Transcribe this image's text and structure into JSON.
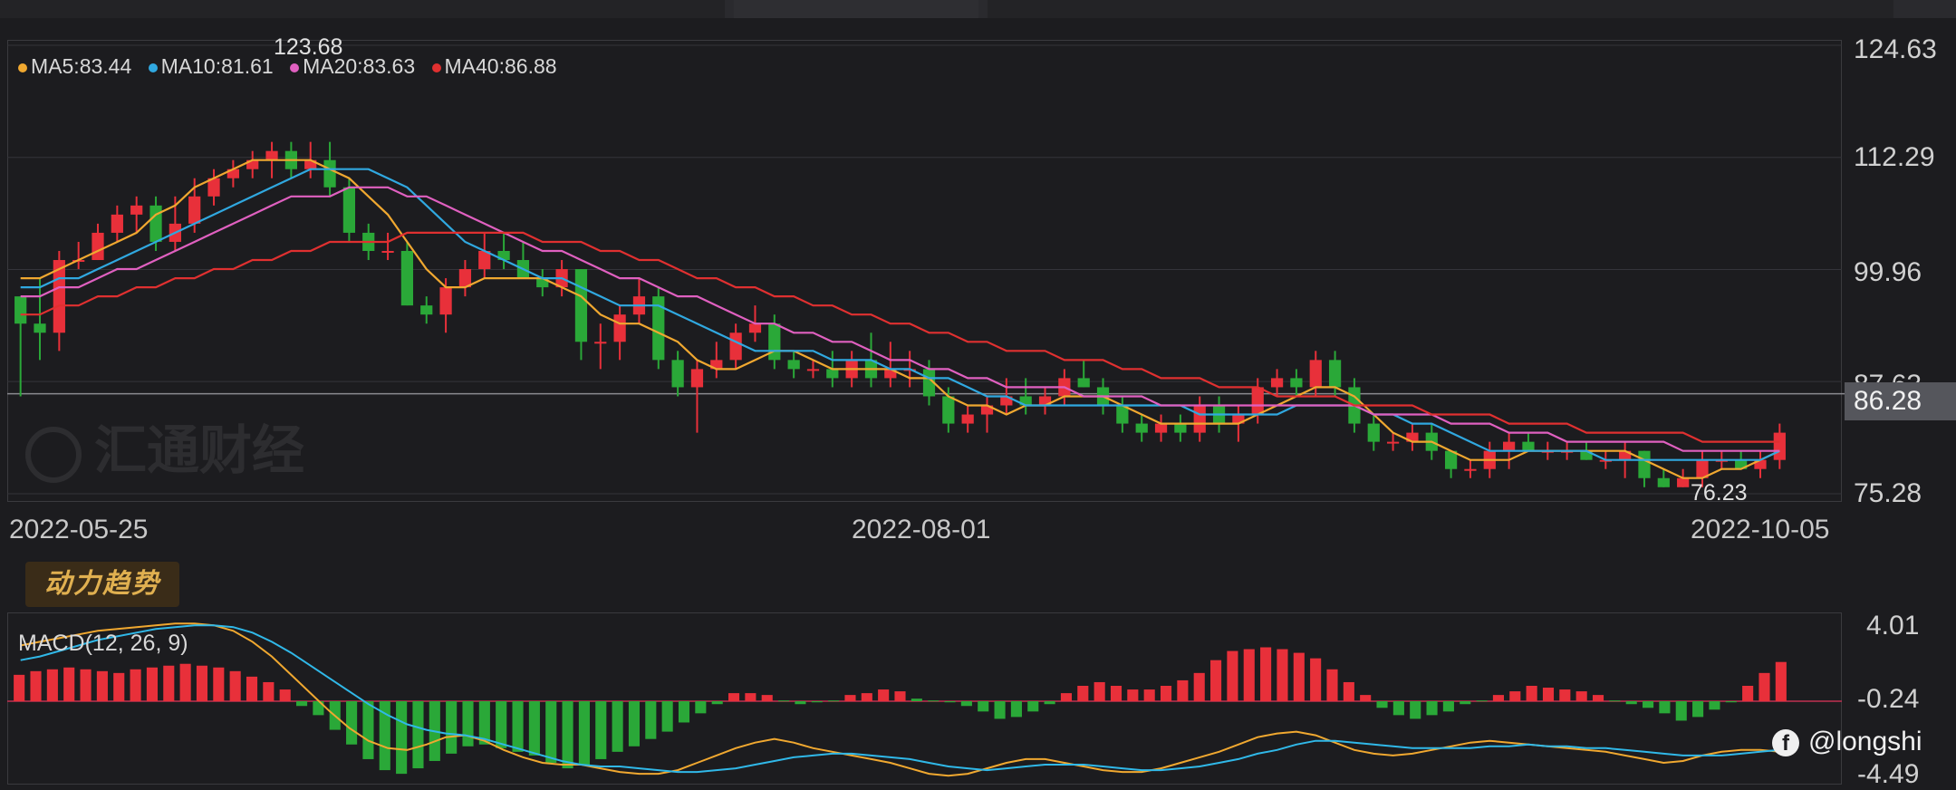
{
  "chart_data": [
    {
      "type": "candlestick",
      "ohlc": [
        [
          97,
          86,
          97,
          94
        ],
        [
          94,
          90,
          99,
          93
        ],
        [
          93,
          91,
          102,
          101
        ],
        [
          101,
          100,
          103,
          101
        ],
        [
          101,
          101,
          105,
          104
        ],
        [
          104,
          103,
          107,
          106
        ],
        [
          106,
          104,
          108,
          107
        ],
        [
          107,
          102,
          108,
          103
        ],
        [
          103,
          102,
          108,
          105
        ],
        [
          105,
          104,
          110,
          108
        ],
        [
          108,
          107,
          111,
          110
        ],
        [
          110,
          109,
          112,
          111
        ],
        [
          111,
          110,
          113,
          112
        ],
        [
          112,
          110,
          114,
          113
        ],
        [
          113,
          110,
          114,
          111
        ],
        [
          111,
          110,
          114,
          112
        ],
        [
          112,
          108,
          114,
          109
        ],
        [
          109,
          103,
          110,
          104
        ],
        [
          104,
          101,
          105,
          102
        ],
        [
          102,
          101,
          104,
          102
        ],
        [
          102,
          96,
          103,
          96
        ],
        [
          96,
          94,
          97,
          95
        ],
        [
          95,
          93,
          99,
          98
        ],
        [
          98,
          97,
          101,
          100
        ],
        [
          100,
          99,
          104,
          102
        ],
        [
          102,
          100,
          104,
          101
        ],
        [
          101,
          99,
          103,
          99
        ],
        [
          99,
          97,
          100,
          98
        ],
        [
          98,
          97,
          101,
          100
        ],
        [
          100,
          90,
          100,
          92
        ],
        [
          92,
          89,
          94,
          92
        ],
        [
          92,
          90,
          96,
          95
        ],
        [
          95,
          94,
          99,
          97
        ],
        [
          97,
          89,
          98,
          90
        ],
        [
          90,
          86,
          91,
          87
        ],
        [
          87,
          82,
          90,
          89
        ],
        [
          89,
          88,
          92,
          90
        ],
        [
          90,
          89,
          94,
          93
        ],
        [
          93,
          92,
          96,
          94
        ],
        [
          94,
          89,
          95,
          90
        ],
        [
          90,
          88,
          91,
          89
        ],
        [
          89,
          88,
          90,
          89
        ],
        [
          89,
          87,
          91,
          88
        ],
        [
          88,
          87,
          91,
          90
        ],
        [
          90,
          87,
          93,
          88
        ],
        [
          88,
          87,
          92,
          89
        ],
        [
          89,
          87,
          91,
          89
        ],
        [
          89,
          85,
          90,
          86
        ],
        [
          86,
          82,
          87,
          83
        ],
        [
          83,
          82,
          85,
          84
        ],
        [
          84,
          82,
          86,
          85
        ],
        [
          85,
          84,
          88,
          86
        ],
        [
          86,
          84,
          88,
          85
        ],
        [
          85,
          84,
          87,
          86
        ],
        [
          86,
          85,
          89,
          88
        ],
        [
          88,
          87,
          90,
          87
        ],
        [
          87,
          84,
          88,
          85
        ],
        [
          85,
          82,
          86,
          83
        ],
        [
          83,
          81,
          84,
          82
        ],
        [
          82,
          81,
          84,
          83
        ],
        [
          83,
          81,
          84,
          82
        ],
        [
          82,
          81,
          86,
          85
        ],
        [
          85,
          82,
          86,
          83
        ],
        [
          83,
          81,
          85,
          84
        ],
        [
          84,
          83,
          88,
          87
        ],
        [
          87,
          86,
          89,
          88
        ],
        [
          88,
          86,
          89,
          87
        ],
        [
          87,
          86,
          91,
          90
        ],
        [
          90,
          86,
          91,
          87
        ],
        [
          87,
          82,
          88,
          83
        ],
        [
          83,
          80,
          84,
          81
        ],
        [
          81,
          80,
          82,
          81
        ],
        [
          81,
          80,
          83,
          82
        ],
        [
          82,
          79,
          83,
          80
        ],
        [
          80,
          77,
          80,
          78
        ],
        [
          78,
          77,
          79,
          78
        ],
        [
          78,
          77,
          81,
          80
        ],
        [
          80,
          78,
          82,
          81
        ],
        [
          81,
          80,
          82,
          80
        ],
        [
          80,
          79,
          81,
          80
        ],
        [
          80,
          79,
          81,
          80
        ],
        [
          80,
          79,
          81,
          79
        ],
        [
          79,
          78,
          80,
          79
        ],
        [
          79,
          77,
          81,
          80
        ],
        [
          80,
          76,
          80,
          77
        ],
        [
          77,
          76,
          78,
          76
        ],
        [
          76,
          76,
          78,
          77
        ],
        [
          77,
          76,
          80,
          79
        ],
        [
          79,
          78,
          80,
          79
        ],
        [
          79,
          78,
          80,
          78
        ],
        [
          78,
          77,
          80,
          79
        ],
        [
          79,
          78,
          83,
          82
        ]
      ],
      "ma_series": [
        {
          "name": "MA5",
          "value_label": "83.44",
          "color": "#f0a830",
          "values": [
            99,
            99,
            100,
            101,
            102,
            103,
            104,
            106,
            107,
            109,
            110,
            111,
            112,
            112,
            112,
            112,
            111,
            110,
            108,
            106,
            103,
            100,
            98,
            98,
            99,
            99,
            99,
            99,
            98,
            97,
            95,
            94,
            94,
            93,
            92,
            90,
            89,
            89,
            90,
            91,
            91,
            90,
            89,
            89,
            89,
            89,
            88,
            88,
            86,
            85,
            85,
            84,
            85,
            85,
            86,
            86,
            86,
            85,
            84,
            83,
            83,
            83,
            83,
            83,
            84,
            85,
            86,
            87,
            87,
            86,
            84,
            82,
            81,
            81,
            80,
            79,
            79,
            79,
            80,
            80,
            80,
            80,
            80,
            80,
            79,
            78,
            77,
            77,
            78,
            78,
            79,
            80
          ]
        },
        {
          "name": "MA10",
          "value_label": "81.61",
          "color": "#30a8e0",
          "values": [
            98,
            98,
            99,
            99,
            100,
            101,
            102,
            103,
            104,
            105,
            106,
            107,
            108,
            109,
            110,
            111,
            111,
            111,
            111,
            110,
            109,
            107,
            105,
            103,
            102,
            101,
            100,
            99,
            99,
            98,
            97,
            96,
            96,
            96,
            95,
            94,
            93,
            92,
            91,
            91,
            91,
            91,
            90,
            90,
            90,
            89,
            89,
            88,
            88,
            87,
            86,
            86,
            85,
            85,
            85,
            85,
            85,
            85,
            85,
            85,
            85,
            84,
            84,
            84,
            84,
            84,
            85,
            85,
            85,
            85,
            84,
            84,
            83,
            83,
            82,
            81,
            80,
            80,
            80,
            80,
            80,
            80,
            79,
            79,
            79,
            79,
            79,
            79,
            79,
            79,
            79,
            80
          ]
        },
        {
          "name": "MA20",
          "value_label": "83.63",
          "color": "#e060c0",
          "values": [
            97,
            97,
            98,
            98,
            99,
            100,
            100,
            101,
            102,
            103,
            104,
            105,
            106,
            107,
            108,
            108,
            108,
            109,
            109,
            109,
            108,
            108,
            107,
            106,
            105,
            104,
            103,
            102,
            102,
            101,
            100,
            99,
            99,
            98,
            97,
            97,
            96,
            95,
            94,
            94,
            93,
            93,
            92,
            92,
            91,
            90,
            90,
            89,
            89,
            88,
            88,
            87,
            87,
            87,
            87,
            86,
            86,
            86,
            86,
            85,
            85,
            85,
            85,
            85,
            85,
            85,
            85,
            85,
            85,
            85,
            84,
            84,
            84,
            84,
            83,
            83,
            83,
            82,
            82,
            82,
            81,
            81,
            81,
            81,
            81,
            81,
            80,
            80,
            80,
            80,
            80,
            80
          ]
        },
        {
          "name": "MA40",
          "value_label": "86.88",
          "color": "#e03030",
          "values": [
            95,
            95,
            96,
            96,
            97,
            97,
            98,
            98,
            99,
            99,
            100,
            100,
            101,
            101,
            102,
            102,
            103,
            103,
            103,
            103,
            104,
            104,
            104,
            104,
            104,
            104,
            104,
            103,
            103,
            103,
            102,
            102,
            101,
            101,
            100,
            99,
            99,
            98,
            98,
            97,
            97,
            96,
            96,
            95,
            95,
            94,
            94,
            93,
            93,
            92,
            92,
            91,
            91,
            91,
            90,
            90,
            90,
            89,
            89,
            88,
            88,
            88,
            87,
            87,
            87,
            86,
            86,
            86,
            86,
            85,
            85,
            85,
            85,
            84,
            84,
            84,
            84,
            83,
            83,
            83,
            83,
            82,
            82,
            82,
            82,
            82,
            82,
            81,
            81,
            81,
            81,
            81
          ]
        }
      ],
      "y_ticks": [
        "124.63",
        "112.29",
        "99.96",
        "87.63",
        "75.28"
      ],
      "ylim": [
        75.28,
        124.63
      ],
      "x_ticks": [
        "2022-05-25",
        "2022-08-01",
        "2022-10-05"
      ],
      "last_price": "86.28",
      "high_label": "123.68",
      "low_label": "76.23",
      "up_color": "#e8303a",
      "down_color": "#2aa838"
    },
    {
      "type": "macd",
      "title": "MACD(12, 26, 9)",
      "hist": [
        1.2,
        1.4,
        1.5,
        1.6,
        1.5,
        1.4,
        1.3,
        1.5,
        1.6,
        1.7,
        1.8,
        1.7,
        1.6,
        1.4,
        1.1,
        0.8,
        0.4,
        -0.5,
        -1.0,
        -1.8,
        -2.6,
        -3.4,
        -4.0,
        -4.2,
        -3.9,
        -3.5,
        -3.1,
        -2.7,
        -2.6,
        -2.8,
        -3.0,
        -3.2,
        -3.6,
        -3.9,
        -3.7,
        -3.4,
        -3.0,
        -2.7,
        -2.3,
        -1.9,
        -1.4,
        -0.9,
        -0.4,
        0.2,
        0.2,
        0.1,
        -0.2,
        -0.4,
        -0.3,
        -0.2,
        0.1,
        0.2,
        0.4,
        0.3,
        -0.1,
        -0.2,
        -0.3,
        -0.5,
        -0.8,
        -1.2,
        -1.1,
        -0.8,
        -0.4,
        0.2,
        0.6,
        0.8,
        0.6,
        0.4,
        0.4,
        0.6,
        0.9,
        1.3,
        2.0,
        2.5,
        2.6,
        2.7,
        2.6,
        2.4,
        2.1,
        1.5,
        0.8,
        0.1,
        -0.6,
        -1.0,
        -1.2,
        -1.0,
        -0.8,
        -0.4,
        -0.2,
        0.1,
        0.3,
        0.6,
        0.5,
        0.4,
        0.3,
        0.1,
        -0.2,
        -0.4,
        -0.6,
        -0.9,
        -1.3,
        -1.1,
        -0.7,
        -0.3,
        0.6,
        1.3,
        1.9
      ],
      "dif": [
        2.8,
        3.0,
        3.2,
        3.4,
        3.6,
        3.7,
        3.8,
        3.9,
        4.0,
        4.0,
        3.9,
        3.6,
        3.0,
        2.2,
        1.2,
        0.2,
        -0.8,
        -1.7,
        -2.4,
        -2.8,
        -2.9,
        -2.6,
        -2.2,
        -2.1,
        -2.4,
        -2.9,
        -3.3,
        -3.6,
        -3.7,
        -3.7,
        -3.9,
        -4.1,
        -4.2,
        -4.2,
        -4.0,
        -3.6,
        -3.2,
        -2.8,
        -2.5,
        -2.3,
        -2.5,
        -2.8,
        -3.0,
        -3.2,
        -3.4,
        -3.6,
        -3.9,
        -4.2,
        -4.3,
        -4.2,
        -3.9,
        -3.6,
        -3.4,
        -3.4,
        -3.6,
        -3.8,
        -4.0,
        -4.1,
        -4.1,
        -3.9,
        -3.6,
        -3.3,
        -3.0,
        -2.6,
        -2.2,
        -2.0,
        -1.9,
        -2.1,
        -2.5,
        -2.9,
        -3.1,
        -3.2,
        -3.1,
        -2.9,
        -2.7,
        -2.5,
        -2.4,
        -2.5,
        -2.6,
        -2.7,
        -2.8,
        -2.9,
        -3.0,
        -3.2,
        -3.4,
        -3.6,
        -3.5,
        -3.2,
        -3.0,
        -2.9,
        -2.9,
        -3.0
      ],
      "dea": [
        2.0,
        2.2,
        2.5,
        2.8,
        3.1,
        3.3,
        3.5,
        3.7,
        3.8,
        3.9,
        3.9,
        3.8,
        3.5,
        3.0,
        2.4,
        1.7,
        1.0,
        0.3,
        -0.4,
        -1.0,
        -1.5,
        -1.8,
        -2.0,
        -2.1,
        -2.3,
        -2.6,
        -2.9,
        -3.2,
        -3.5,
        -3.7,
        -3.8,
        -3.8,
        -3.9,
        -4.0,
        -4.1,
        -4.1,
        -4.0,
        -3.9,
        -3.7,
        -3.5,
        -3.3,
        -3.2,
        -3.1,
        -3.1,
        -3.2,
        -3.3,
        -3.4,
        -3.6,
        -3.8,
        -3.9,
        -4.0,
        -3.9,
        -3.8,
        -3.7,
        -3.7,
        -3.7,
        -3.8,
        -3.9,
        -4.0,
        -4.0,
        -3.9,
        -3.8,
        -3.6,
        -3.4,
        -3.1,
        -2.9,
        -2.6,
        -2.4,
        -2.4,
        -2.5,
        -2.6,
        -2.7,
        -2.8,
        -2.8,
        -2.8,
        -2.8,
        -2.7,
        -2.7,
        -2.6,
        -2.7,
        -2.7,
        -2.8,
        -2.8,
        -2.9,
        -3.0,
        -3.1,
        -3.2,
        -3.2,
        -3.2,
        -3.1,
        -3.0,
        -2.9
      ],
      "dif_color": "#f0a830",
      "dea_color": "#30b8e8",
      "y_ticks": [
        "4.01",
        "-0.24",
        "-4.49"
      ],
      "ylim": [
        -4.49,
        4.01
      ]
    }
  ],
  "indicator_badge": "动力趋势",
  "watermark": "汇通财经",
  "social_handle": "@longshi",
  "social_icon": "facebook-icon"
}
